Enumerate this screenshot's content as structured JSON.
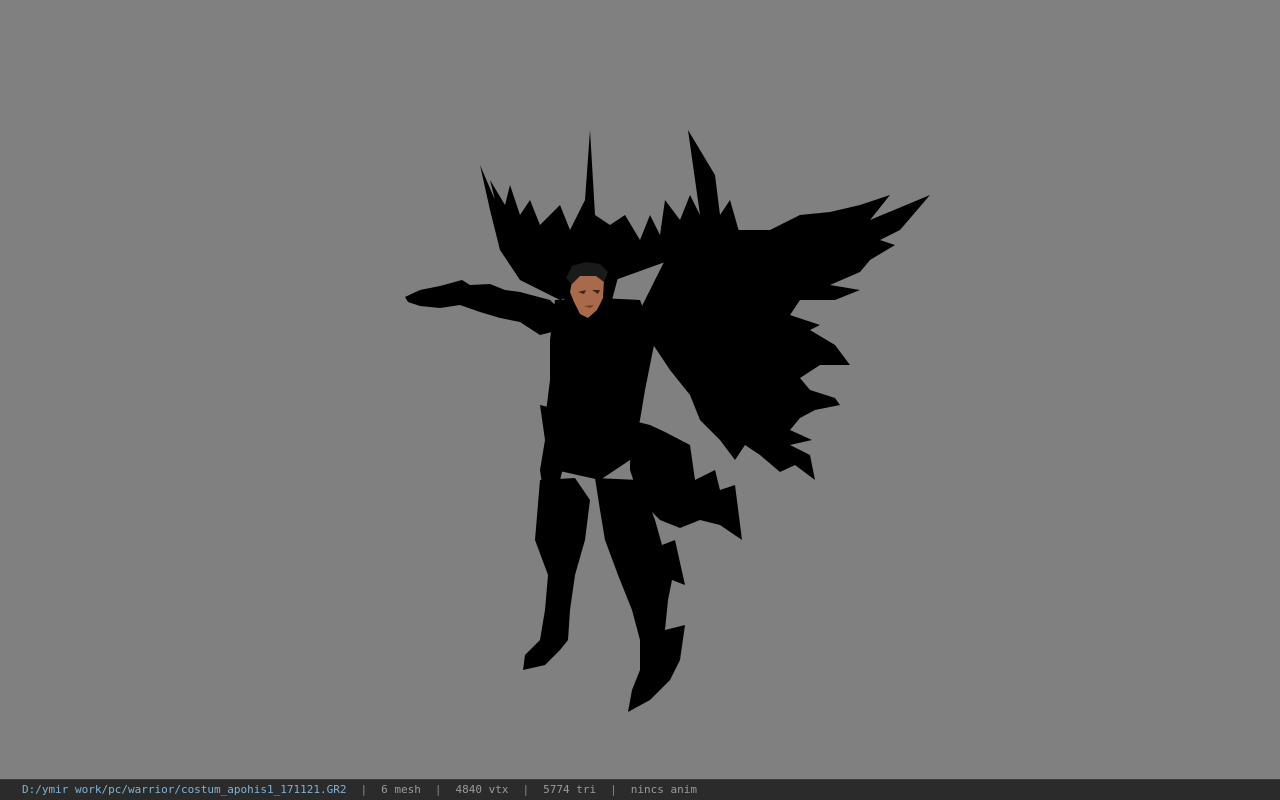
{
  "viewport": {
    "background_color": "#808080",
    "model_color": "#000000",
    "skin_color": "#a86a4a"
  },
  "statusbar": {
    "file_path": "D:/ymir work/pc/warrior/costum_apohis1_171121.GR2",
    "separator": "|",
    "mesh_count": "6 mesh",
    "vertex_count": "4840 vtx",
    "triangle_count": "5774 tri",
    "anim_status": "nincs anim"
  }
}
